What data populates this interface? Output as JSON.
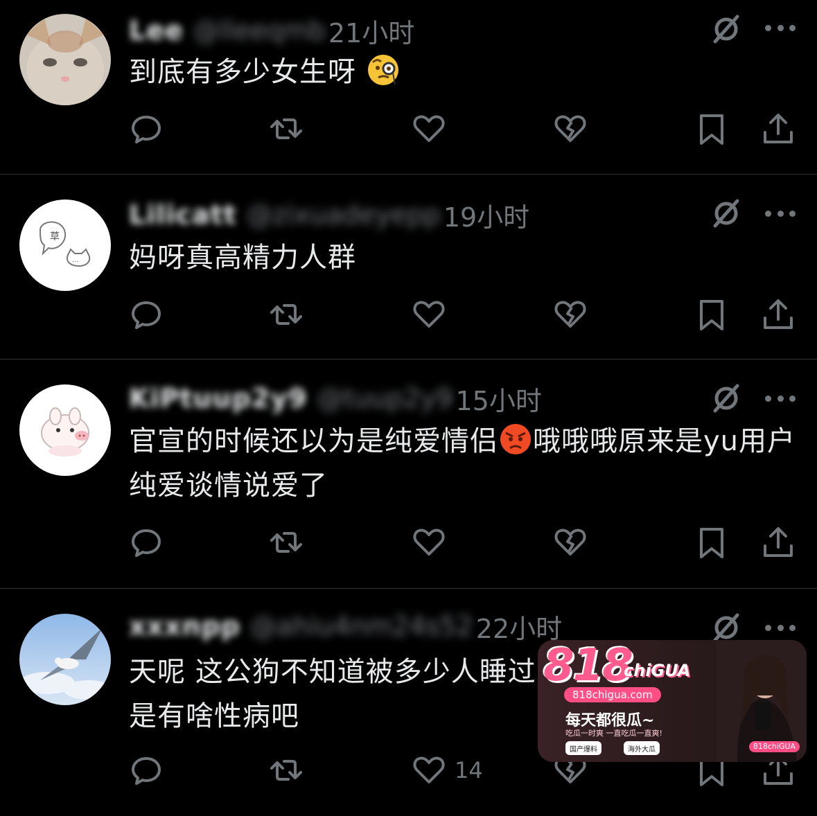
{
  "posts": [
    {
      "name": "Lee",
      "handle": "@lleeqmb",
      "time": "21小时",
      "text": "到底有多少女生呀",
      "emoji": "face-with-monocle",
      "like_count": ""
    },
    {
      "name": "Lilicatt",
      "handle": "@zixuadeyepp",
      "time": "19小时",
      "text": "妈呀真高精力人群",
      "emoji": "",
      "like_count": ""
    },
    {
      "name": "KiPtuup2y9",
      "handle": "@tuup2y9",
      "time": "15小时",
      "text_before": "官宣的时候还以为是纯爱情侣",
      "text_after": "哦哦哦原来是yu用户纯爱谈情说爱了",
      "emoji": "angry-face",
      "like_count": ""
    },
    {
      "name": "xxxnpp",
      "handle": "@ahiu4nm24s52",
      "time": "22小时",
      "text": "天呢 这公狗不知道被多少人睡过了还要撸只撸，不会是有啥性病吧",
      "emoji": "",
      "like_count": "14"
    }
  ],
  "icons": {
    "reply": "reply-icon",
    "repost": "repost-icon",
    "like": "like-icon",
    "dislike": "broken-heart-icon",
    "bookmark": "bookmark-icon",
    "share": "share-icon",
    "grok": "grok-icon",
    "more": "more-icon"
  },
  "watermark": {
    "logo_number": "818",
    "logo_brand": "chiGUA",
    "domain": "818chigua.com",
    "slogan": "每天都很瓜~",
    "sub": "吃瓜一时爽 一直吃瓜一直爽!",
    "pill_1": "国产爆料",
    "pill_2": "海外大瓜",
    "tag": "818chiGUA"
  },
  "colors": {
    "background": "#000000",
    "text": "#e7e9ea",
    "secondary": "#71767b",
    "divider": "#2f3336",
    "brand_pink": "#ff4d86"
  }
}
